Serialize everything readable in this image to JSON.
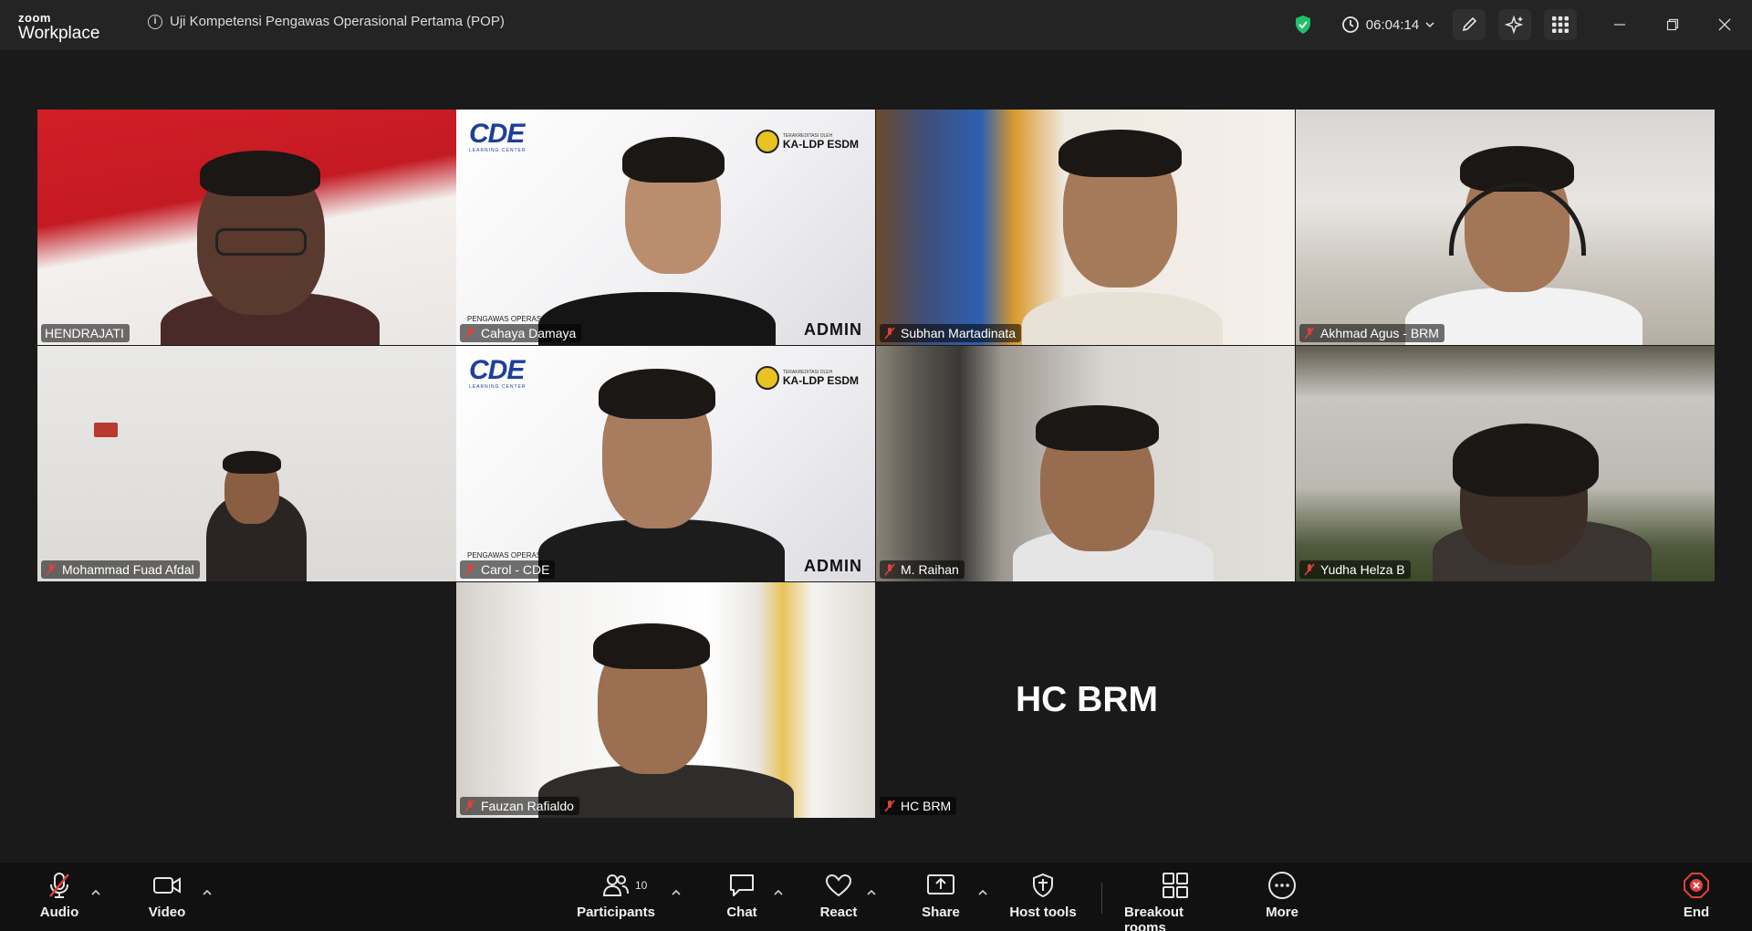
{
  "app": {
    "brand_top": "zoom",
    "brand_bottom": "Workplace"
  },
  "meeting": {
    "title": "Uji Kompetensi Pengawas Operasional Pertama (POP)",
    "timer": "06:04:14"
  },
  "title_bar": {
    "icons": [
      "shield-check-icon",
      "clock-icon",
      "chevron-down-icon",
      "pen-icon",
      "ai-sparkle-icon",
      "apps-grid-icon",
      "minimize-icon",
      "restore-icon",
      "close-icon"
    ]
  },
  "participants": [
    {
      "name": "HENDRAJATI",
      "muted": false,
      "speaking": true
    },
    {
      "name": "Cahaya Damaya",
      "muted": true
    },
    {
      "name": "Subhan Martadinata",
      "muted": true
    },
    {
      "name": "Akhmad Agus - BRM",
      "muted": true
    },
    {
      "name": "Mohammad Fuad Afdal",
      "muted": true
    },
    {
      "name": "Carol - CDE",
      "muted": true
    },
    {
      "name": "M. Raihan",
      "muted": true
    },
    {
      "name": "Yudha Helza B",
      "muted": true
    },
    {
      "name": "Fauzan Rafialdo",
      "muted": true
    },
    {
      "name": "HC BRM",
      "muted": true,
      "video_off": true
    }
  ],
  "background_overlay": {
    "cde": "CDE",
    "learning_center": "LEARNING CENTER",
    "accredited_by": "TERAKREDITASI OLEH",
    "kalsp": "KA-LDP ESDM",
    "admin": "ADMIN",
    "pengawas": "PENGAWAS OPERAS"
  },
  "camera_off_label": "HC BRM",
  "toolbar": {
    "audio": "Audio",
    "video": "Video",
    "participants": "Participants",
    "participant_count": "10",
    "chat": "Chat",
    "react": "React",
    "share": "Share",
    "host_tools": "Host tools",
    "breakout_rooms": "Breakout rooms",
    "more": "More",
    "end": "End"
  },
  "colors": {
    "speaking_border": "#2fd38a",
    "mute_red": "#e0413a",
    "shield_green": "#1fbf6a",
    "end_red": "#e0413a"
  }
}
